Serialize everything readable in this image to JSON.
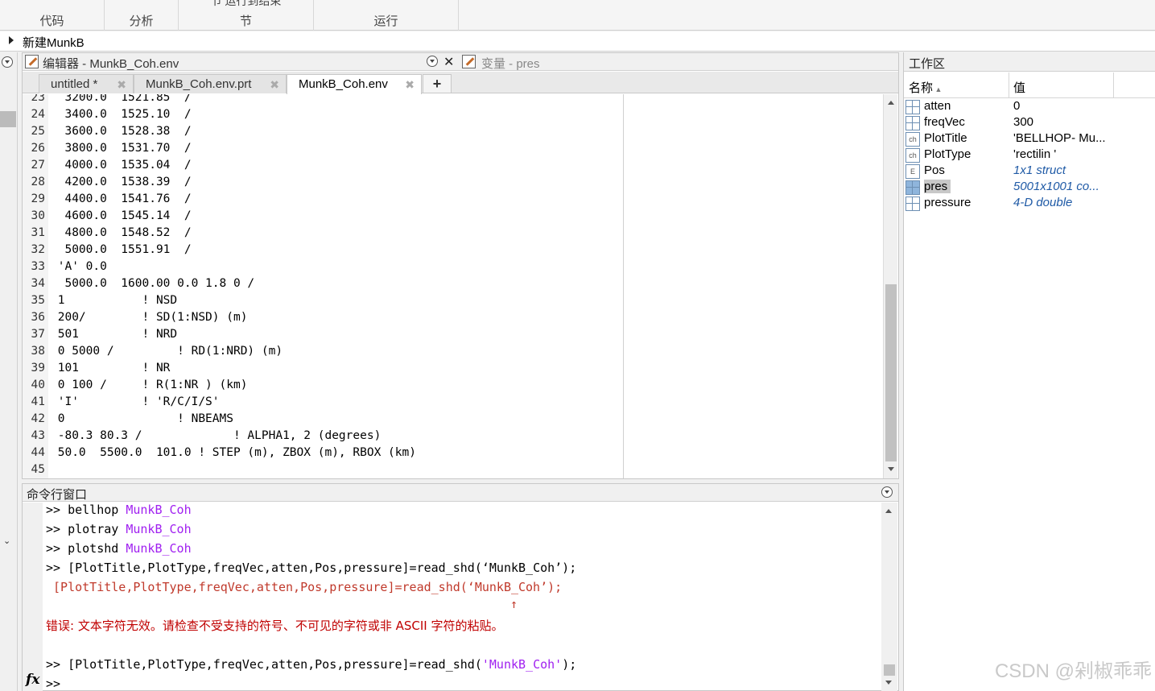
{
  "toolstrip": {
    "sections": [
      {
        "label": "代码",
        "top": ""
      },
      {
        "label": "分析",
        "top": ""
      },
      {
        "label": "节",
        "top": "节         运行到结束"
      },
      {
        "label": "运行",
        "top": ""
      }
    ]
  },
  "address": {
    "folder": "新建MunkB"
  },
  "editor": {
    "title": "编辑器 - MunkB_Coh.env",
    "variable_title": "变量 - pres",
    "tabs": [
      {
        "label": "untitled *",
        "active": false
      },
      {
        "label": "MunkB_Coh.env.prt",
        "active": false
      },
      {
        "label": "MunkB_Coh.env",
        "active": true
      }
    ],
    "lines": [
      {
        "n": "23",
        "text": "  3200.0  1521.85  /"
      },
      {
        "n": "24",
        "text": "  3400.0  1525.10  /"
      },
      {
        "n": "25",
        "text": "  3600.0  1528.38  /"
      },
      {
        "n": "26",
        "text": "  3800.0  1531.70  /"
      },
      {
        "n": "27",
        "text": "  4000.0  1535.04  /"
      },
      {
        "n": "28",
        "text": "  4200.0  1538.39  /"
      },
      {
        "n": "29",
        "text": "  4400.0  1541.76  /"
      },
      {
        "n": "30",
        "text": "  4600.0  1545.14  /"
      },
      {
        "n": "31",
        "text": "  4800.0  1548.52  /"
      },
      {
        "n": "32",
        "text": "  5000.0  1551.91  /"
      },
      {
        "n": "33",
        "text": " 'A' 0.0"
      },
      {
        "n": "34",
        "text": "  5000.0  1600.00 0.0 1.8 0 /"
      },
      {
        "n": "35",
        "text": " 1           ! NSD"
      },
      {
        "n": "36",
        "text": " 200/        ! SD(1:NSD) (m)"
      },
      {
        "n": "37",
        "text": " 501         ! NRD"
      },
      {
        "n": "38",
        "text": " 0 5000 /         ! RD(1:NRD) (m)"
      },
      {
        "n": "39",
        "text": " 101         ! NR"
      },
      {
        "n": "40",
        "text": " 0 100 /     ! R(1:NR ) (km)"
      },
      {
        "n": "41",
        "text": " 'I'         ! 'R/C/I/S'"
      },
      {
        "n": "42",
        "text": " 0                ! NBEAMS"
      },
      {
        "n": "43",
        "text": " -80.3 80.3 /             ! ALPHA1, 2 (degrees)"
      },
      {
        "n": "44",
        "text": " 50.0  5500.0  101.0 ! STEP (m), ZBOX (m), RBOX (km)"
      },
      {
        "n": "45",
        "text": ""
      }
    ]
  },
  "command": {
    "title": "命令行窗口",
    "lines": [
      {
        "prompt": ">> ",
        "cmd": "bellhop ",
        "arg": "MunkB_Coh"
      },
      {
        "prompt": ">> ",
        "cmd": "plotray ",
        "arg": "MunkB_Coh"
      },
      {
        "prompt": ">> ",
        "cmd": "plotshd ",
        "arg": "MunkB_Coh"
      },
      {
        "prompt": ">> ",
        "cmd": "[PlotTitle,PlotType,freqVec,atten,Pos,pressure]=read_shd(‘MunkB_Coh’);",
        "arg": ""
      }
    ],
    "echo": " [PlotTitle,PlotType,freqVec,atten,Pos,pressure]=read_shd(‘MunkB_Coh’);",
    "caret": "↑",
    "error": "错误: 文本字符无效。请检查不受支持的符号、不可见的字符或非 ASCII 字符的粘贴。",
    "last_prompt": ">> ",
    "last_cmd_a": "[PlotTitle,PlotType,freqVec,atten,Pos,pressure]=read_shd(",
    "last_cmd_b": "'MunkB_Coh'",
    "last_cmd_c": ");",
    "current_prompt": ">>",
    "fx": "fx"
  },
  "workspace": {
    "title": "工作区",
    "col_name": "名称",
    "col_value": "值",
    "vars": [
      {
        "name": "atten",
        "value": "0",
        "icon": "grid",
        "italic": false,
        "selected": false
      },
      {
        "name": "freqVec",
        "value": "300",
        "icon": "grid",
        "italic": false,
        "selected": false
      },
      {
        "name": "PlotTitle",
        "value": "'BELLHOP- Mu...",
        "icon": "ch",
        "italic": false,
        "selected": false
      },
      {
        "name": "PlotType",
        "value": "'rectilin  '",
        "icon": "ch",
        "italic": false,
        "selected": false
      },
      {
        "name": "Pos",
        "value": "1x1 struct",
        "icon": "struct",
        "italic": true,
        "selected": false
      },
      {
        "name": "pres",
        "value": "5001x1001 co...",
        "icon": "fill",
        "italic": true,
        "selected": true
      },
      {
        "name": "pressure",
        "value": "4-D double",
        "icon": "grid",
        "italic": true,
        "selected": false
      }
    ]
  },
  "watermark": "CSDN @剁椒乖乖"
}
